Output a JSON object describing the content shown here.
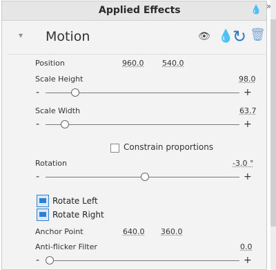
{
  "panel": {
    "title": "Applied Effects",
    "header_icon": "drop-icon",
    "arrows": "»"
  },
  "effect": {
    "name": "Motion",
    "caret": "▾",
    "eye": "●",
    "drop": "●",
    "refresh": "↻",
    "trash": "🗑"
  },
  "position": {
    "label": "Position",
    "x": "960.0",
    "y": "540.0"
  },
  "scale_height": {
    "label": "Scale Height",
    "value": "98.0",
    "level_percent": 13
  },
  "scale_width": {
    "label": "Scale Width",
    "value": "63.7",
    "level_percent": 8
  },
  "constrain": {
    "label": "Constrain proportions",
    "checked": false
  },
  "rotation": {
    "label": "Rotation",
    "value": "-3.0 °",
    "level_percent": 49
  },
  "rotate_left": {
    "label": "Rotate Left"
  },
  "rotate_right": {
    "label": "Rotate Right"
  },
  "anchor": {
    "label": "Anchor Point",
    "x": "640.0",
    "y": "360.0"
  },
  "anti_flicker": {
    "label": "Anti-flicker Filter",
    "value": "0.0",
    "level_percent": 0
  },
  "controls": {
    "minus": "-",
    "plus": "+"
  }
}
